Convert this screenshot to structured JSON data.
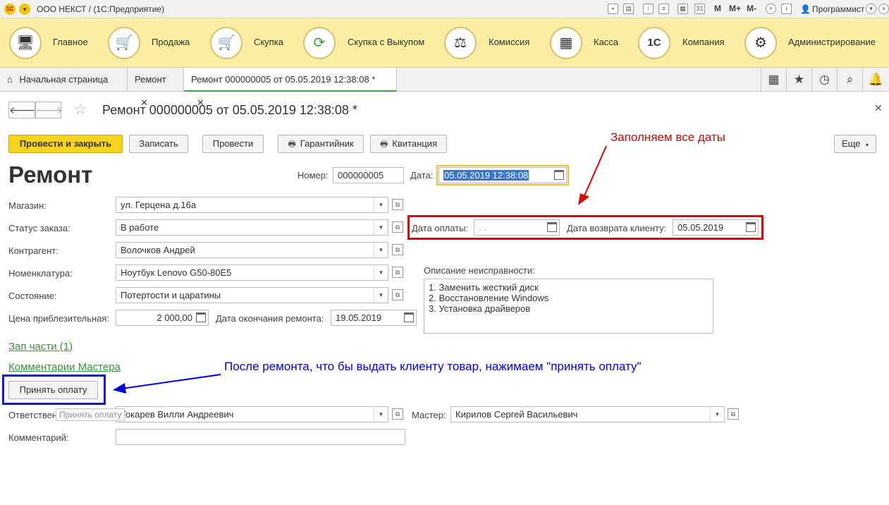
{
  "titlebar": {
    "logo": "1С",
    "title": "ООО НЕКСТ /  (1С:Предприятие)",
    "m1": "M",
    "m2": "M+",
    "m3": "M-",
    "user": "Программист"
  },
  "sections": [
    {
      "label": "Главное",
      "icon": "computer-icon",
      "glyph": "🖥"
    },
    {
      "label": "Продажа",
      "icon": "cart-up-icon",
      "glyph": "🛒"
    },
    {
      "label": "Скупка",
      "icon": "cart-down-icon",
      "glyph": "🛒"
    },
    {
      "label": "Скупка с Выкупом",
      "icon": "refresh-arrows-icon",
      "glyph": "⟳"
    },
    {
      "label": "Комиссия",
      "icon": "scales-icon",
      "glyph": "⚖"
    },
    {
      "label": "Касса",
      "icon": "cash-register-icon",
      "glyph": "▦"
    },
    {
      "label": "Компания",
      "icon": "1c-company-icon",
      "glyph": "1С"
    },
    {
      "label": "Администрирование",
      "icon": "gears-icon",
      "glyph": "⚙"
    }
  ],
  "tabs": {
    "home": "Начальная страница",
    "repair": "Ремонт",
    "active": "Ремонт 000000005 от 05.05.2019 12:38:08 *"
  },
  "doc": {
    "title": "Ремонт 000000005 от 05.05.2019 12:38:08 *",
    "heading": "Ремонт"
  },
  "buttons": {
    "post_close": "Провести и закрыть",
    "save": "Записать",
    "post": "Провести",
    "warranty": "Гарантийник",
    "receipt": "Квитанция",
    "more": "Еще"
  },
  "form": {
    "number_label": "Номер:",
    "number": "000000005",
    "date_label": "Дата:",
    "date": "05.05.2019 12:38:08",
    "store_label": "Магазин:",
    "store": "ул. Герцена д.16а",
    "status_label": "Статус заказа:",
    "status": "В работе",
    "pay_date_label": "Дата оплаты:",
    "pay_date": " .  .",
    "return_date_label": "Дата возврата клиенту:",
    "return_date": "05.05.2019",
    "contractor_label": "Контрагент:",
    "contractor": "Волочков Андрей",
    "nomenclature_label": "Номенклатура:",
    "nomenclature": "Ноутбук Lenovo G50-80E5",
    "condition_label": "Состояние:",
    "condition": "Потертости и царатины",
    "price_label": "Цена приблезительная:",
    "price": "2 000,00",
    "end_date_label": "Дата окончания ремонта:",
    "end_date": "19.05.2019",
    "fault_label": "Описание неисправности:",
    "fault_lines": [
      "1. Заменить жесткий диск",
      "2. Восстановление Windows",
      "3. Установка драйверов"
    ],
    "parts_link": "Зап части (1)",
    "comments_link": "Комментарии Мастера",
    "accept_payment": "Принять оплату",
    "tooltip": "Принять оплату",
    "responsible_label": "Ответственный:",
    "responsible": "Токарев Вилли Андреевич",
    "master_label": "Мастер:",
    "master": "Кирилов Сергей Васильевич",
    "comment_label": "Комментарий:",
    "comment": ""
  },
  "annotations": {
    "dates_note": "Заполняем все даты",
    "payment_note": "После ремонта, что бы выдать клиенту товар, нажимаем \"принять оплату\"",
    "red": "#e00000",
    "blue": "#0000e0"
  },
  "colors": {
    "sections_bg": "#fbeea3",
    "primary_button": "#f6d21c",
    "link_green": "#3a8f3a",
    "active_tab_underline": "#4b9e4b"
  }
}
